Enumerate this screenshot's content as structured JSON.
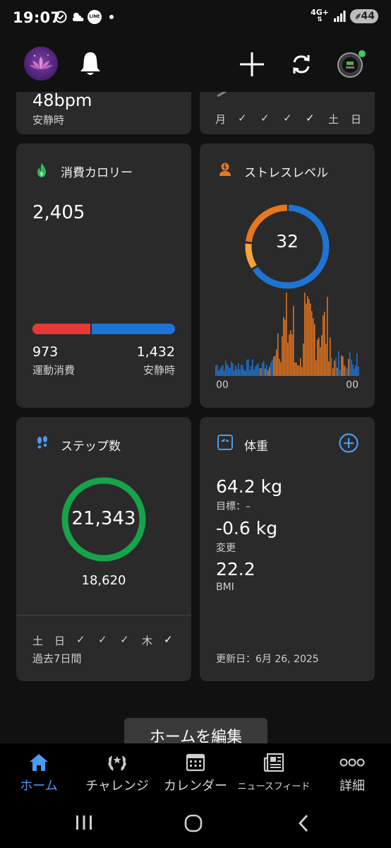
{
  "status_bar": {
    "time": "19:07",
    "line_badge": "LINE",
    "network": "4G+",
    "battery": "44"
  },
  "header": {
    "icons": [
      "lotus-avatar",
      "bell-icon",
      "plus-icon",
      "sync-icon",
      "watch-icon"
    ]
  },
  "top_left_card": {
    "value": "48bpm",
    "label": "安静時"
  },
  "top_right_card": {
    "days": [
      "月",
      "✓",
      "✓",
      "✓",
      "✓",
      "土",
      "日"
    ]
  },
  "calories": {
    "title": "消費カロリー",
    "total": "2,405",
    "active_value": "973",
    "active_label": "運動消費",
    "resting_value": "1,432",
    "resting_label": "安静時",
    "active_fraction": 0.405
  },
  "stress": {
    "title": "ストレスレベル",
    "value": "32",
    "axis_start": "00",
    "axis_end": "00"
  },
  "steps": {
    "title": "ステップ数",
    "count": "21,343",
    "goal": "18,620",
    "days": [
      "土",
      "日",
      "✓",
      "✓",
      "✓",
      "木",
      "✓"
    ],
    "footer": "過去7日間"
  },
  "weight": {
    "title": "体重",
    "weight_value": "64.2 kg",
    "goal_label": "目標：–",
    "change_value": "-0.6 kg",
    "change_label": "変更",
    "bmi_value": "22.2",
    "bmi_label": "BMI",
    "updated": "更新日：6月 26, 2025"
  },
  "edit_home_label": "ホームを編集",
  "bottom_nav": {
    "items": [
      {
        "label": "ホーム",
        "icon": "home-icon"
      },
      {
        "label": "チャレンジ",
        "icon": "laurel-icon"
      },
      {
        "label": "カレンダー",
        "icon": "calendar-icon"
      },
      {
        "label": "ニュースフィード",
        "icon": "news-icon"
      },
      {
        "label": "詳細",
        "icon": "more-icon"
      }
    ]
  },
  "colors": {
    "accent_blue": "#4c9bf0",
    "stress_orange": "#e8771e",
    "stress_blue": "#1e74d4",
    "steps_green": "#17a34a",
    "calorie_red": "#e53935",
    "calorie_blue": "#1e74d4"
  }
}
